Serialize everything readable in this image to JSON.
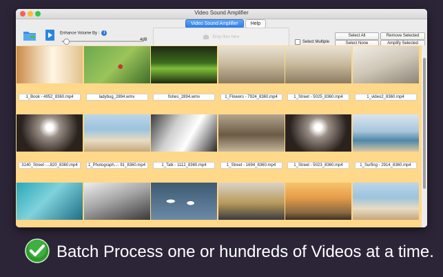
{
  "window": {
    "title": "Video Sound Amplifier"
  },
  "tabs": [
    {
      "label": "Video Sound Amplifier",
      "active": true
    },
    {
      "label": "Help",
      "active": false
    }
  ],
  "toolbar": {
    "enhance_label": "Enhance Volume By :",
    "slider_value": "4dB",
    "slider_level": 0.03,
    "drop_text": "Drop files here",
    "select_multiple_label": "Select Multiple",
    "select_multiple_checked": false,
    "select_all": "Select All",
    "select_none": "Select None",
    "remove_selected": "Remove Selected",
    "amplify_selected": "Amplify Selected"
  },
  "videos": [
    {
      "name": "1_Book - 4952_8360.mp4",
      "scene": "book"
    },
    {
      "name": "ladybug_2894.wmv",
      "scene": "ladybug"
    },
    {
      "name": "fishes_2894.wmv",
      "scene": "fishes"
    },
    {
      "name": "1_Flowers - 7924_8360.mp4",
      "scene": "street"
    },
    {
      "name": "1_Street - 5025_8360.mp4",
      "scene": "street"
    },
    {
      "name": "1_video2_8360.mp4",
      "scene": "video2"
    },
    {
      "name": "3140_Street -...820_8360.mp4",
      "scene": "tunnel"
    },
    {
      "name": "1_Photograph...- 91_8360.mp4",
      "scene": "beach"
    },
    {
      "name": "1_Talk - 1112_8360.mp4",
      "scene": "talk"
    },
    {
      "name": "1_Street - 1694_8360.mp4",
      "scene": "legs"
    },
    {
      "name": "1_Street - 5023_8360.mp4",
      "scene": "tunnel"
    },
    {
      "name": "1_Surfing - 2914_8360.mp4",
      "scene": "surfing"
    },
    {
      "name": "",
      "scene": "aerial"
    },
    {
      "name": "",
      "scene": "piano"
    },
    {
      "name": "",
      "scene": "swans"
    },
    {
      "name": "",
      "scene": "desk"
    },
    {
      "name": "",
      "scene": "yoga"
    },
    {
      "name": "",
      "scene": "beach"
    }
  ],
  "caption": "Batch Process one or hundreds of Videos at a time.",
  "colors": {
    "grid_bg": "#ffd889",
    "accent": "#2c7be8",
    "page_bg": "#2c2538"
  }
}
